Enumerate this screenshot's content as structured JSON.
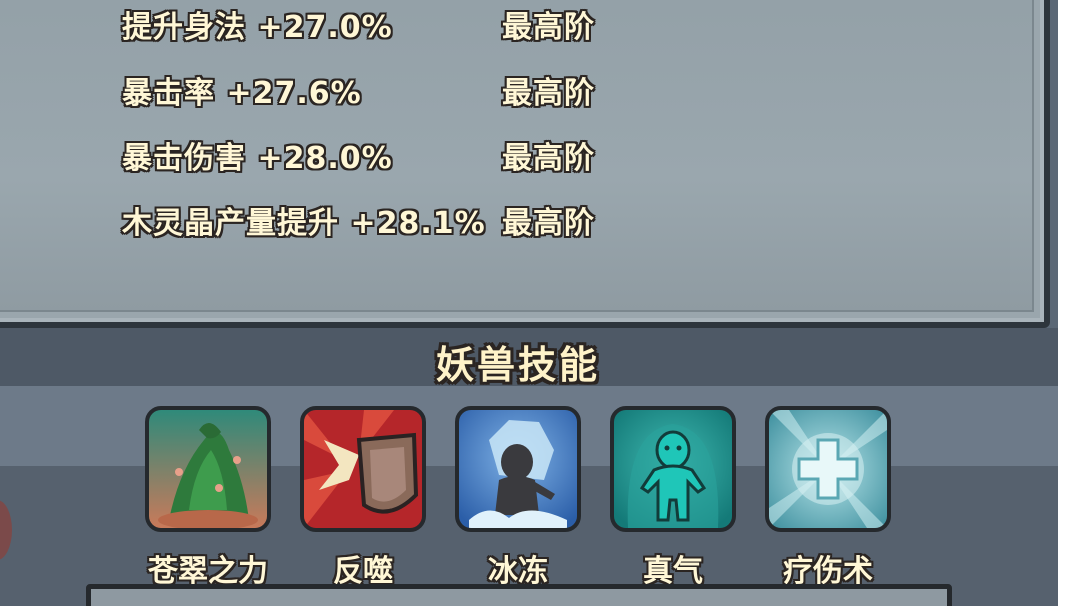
{
  "stats": [
    {
      "text": "提升身法 +27.0%",
      "level": "最高阶"
    },
    {
      "text": "暴击率 +27.6%",
      "level": "最高阶"
    },
    {
      "text": "暴击伤害 +28.0%",
      "level": "最高阶"
    },
    {
      "text": "木灵晶产量提升 +28.1%",
      "level": "最高阶"
    }
  ],
  "section": {
    "title": "妖兽技能"
  },
  "skills": [
    {
      "label": "苍翠之力",
      "icon": "green-vine-icon"
    },
    {
      "label": "反噬",
      "icon": "shield-burst-icon"
    },
    {
      "label": "冰冻",
      "icon": "frozen-figure-icon"
    },
    {
      "label": "真气",
      "icon": "spirit-figure-icon"
    },
    {
      "label": "疗伤术",
      "icon": "healing-cross-icon"
    }
  ],
  "colors": {
    "text": "#fff7d6",
    "outline": "#2b2522",
    "panel": "#9aa6ad",
    "background": "#5b6876"
  }
}
